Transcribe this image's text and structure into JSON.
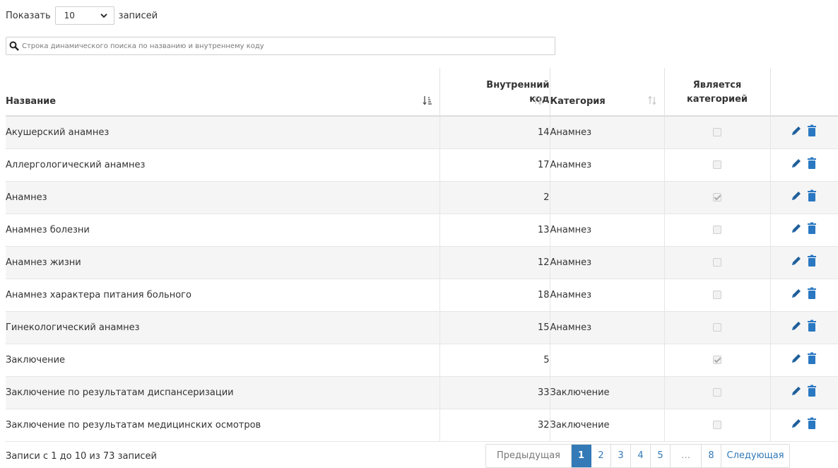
{
  "length": {
    "prefix": "Показать",
    "value": "10",
    "suffix": "записей"
  },
  "search": {
    "placeholder": "Строка динамического поиска по названию и внутреннему коду",
    "icon": "search-icon"
  },
  "table": {
    "headers": {
      "name": "Название",
      "code_line1": "Внутренний",
      "code_line2": "код",
      "category": "Категория",
      "is_category_line1": "Является",
      "is_category_line2": "категорией"
    },
    "rows": [
      {
        "name": "Акушерский анамнез",
        "code": "14",
        "category": "Анамнез",
        "is_category": false
      },
      {
        "name": "Аллергологический анамнез",
        "code": "17",
        "category": "Анамнез",
        "is_category": false
      },
      {
        "name": "Анамнез",
        "code": "2",
        "category": "",
        "is_category": true
      },
      {
        "name": "Анамнез болезни",
        "code": "13",
        "category": "Анамнез",
        "is_category": false
      },
      {
        "name": "Анамнез жизни",
        "code": "12",
        "category": "Анамнез",
        "is_category": false
      },
      {
        "name": "Анамнез характера питания больного",
        "code": "18",
        "category": "Анамнез",
        "is_category": false
      },
      {
        "name": "Гинекологический анамнез",
        "code": "15",
        "category": "Анамнез",
        "is_category": false
      },
      {
        "name": "Заключение",
        "code": "5",
        "category": "",
        "is_category": true
      },
      {
        "name": "Заключение по результатам диспансеризации",
        "code": "33",
        "category": "Заключение",
        "is_category": false
      },
      {
        "name": "Заключение по результатам медицинских осмотров",
        "code": "32",
        "category": "Заключение",
        "is_category": false
      }
    ]
  },
  "footer": {
    "info": "Записи с 1 до 10 из 73 записей",
    "pagination": {
      "prev": "Предыдущая",
      "pages": [
        "1",
        "2",
        "3",
        "4",
        "5",
        "…",
        "8"
      ],
      "active": "1",
      "next": "Следующая"
    }
  },
  "colors": {
    "accent": "#337ab7",
    "row_alt": "#f5f5f5"
  }
}
